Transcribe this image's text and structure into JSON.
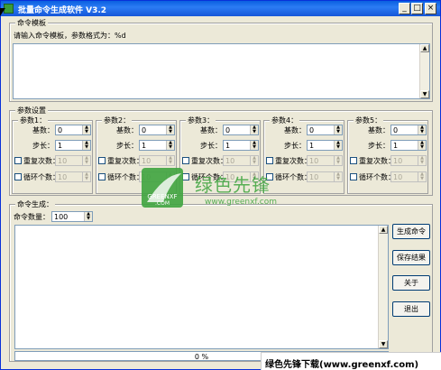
{
  "window": {
    "title": "批量命令生成软件 V3.2",
    "minimize": "_",
    "maximize": "□",
    "close": "×"
  },
  "template_group": {
    "label": "命令模板",
    "hint": "请输入命令模板，参数格式为：%d",
    "value": ""
  },
  "params_group": {
    "label": "参数设置",
    "panels": [
      {
        "title": "参数1：",
        "base_label": "基数：",
        "base_value": "0",
        "step_label": "步长：",
        "step_value": "1",
        "repeat_label": "重复次数：",
        "repeat_value": "10",
        "cycle_label": "循环个数：",
        "cycle_value": "10"
      },
      {
        "title": "参数2：",
        "base_label": "基数：",
        "base_value": "0",
        "step_label": "步长：",
        "step_value": "1",
        "repeat_label": "重复次数：",
        "repeat_value": "10",
        "cycle_label": "循环个数：",
        "cycle_value": "10"
      },
      {
        "title": "参数3：",
        "base_label": "基数：",
        "base_value": "0",
        "step_label": "步长：",
        "step_value": "1",
        "repeat_label": "重复次数：",
        "repeat_value": "10",
        "cycle_label": "循环个数：",
        "cycle_value": "10"
      },
      {
        "title": "参数4：",
        "base_label": "基数：",
        "base_value": "0",
        "step_label": "步长：",
        "step_value": "1",
        "repeat_label": "重复次数：",
        "repeat_value": "10",
        "cycle_label": "循环个数：",
        "cycle_value": "10"
      },
      {
        "title": "参数5：",
        "base_label": "基数：",
        "base_value": "0",
        "step_label": "步长：",
        "step_value": "1",
        "repeat_label": "重复次数：",
        "repeat_value": "10",
        "cycle_label": "循环个数：",
        "cycle_value": "10"
      }
    ]
  },
  "generate_group": {
    "label": "命令生成：",
    "count_label": "命令数量：",
    "count_value": "100",
    "output": "",
    "progress_text": "0 %",
    "progress_fraction": 0
  },
  "buttons": {
    "generate": "生成命令",
    "save": "保存结果",
    "about": "关于",
    "exit": "退出"
  },
  "watermark": {
    "logo_text": "GREENXF .COM",
    "brand": "绿色先锋",
    "url": "www.greenxf.com",
    "banner": "绿色先锋下载(www.greenxf.com)"
  },
  "colors": {
    "title_bar": "#0a5fe0",
    "window_bg": "#ece9d8",
    "watermark_green": "#3fa43f"
  }
}
